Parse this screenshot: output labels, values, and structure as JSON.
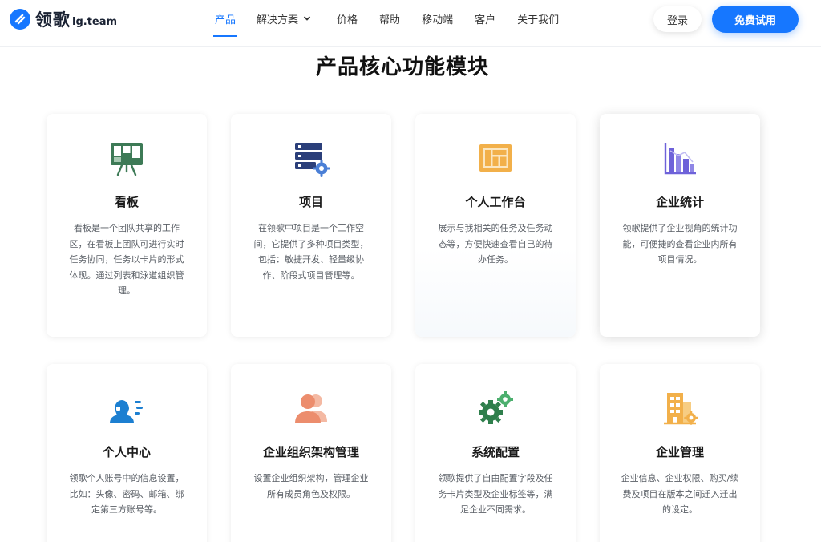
{
  "header": {
    "logo": {
      "name": "领歌",
      "domain": "lg.team"
    },
    "nav": [
      {
        "label": "产品",
        "active": true
      },
      {
        "label": "解决方案",
        "has_dropdown": true
      },
      {
        "label": "价格"
      },
      {
        "label": "帮助"
      },
      {
        "label": "移动端"
      },
      {
        "label": "客户"
      },
      {
        "label": "关于我们"
      }
    ],
    "login_label": "登录",
    "trial_label": "免费试用"
  },
  "section": {
    "title": "产品核心功能模块"
  },
  "cards": [
    {
      "title": "看板",
      "icon": "kanban-board-icon",
      "desc": "看板是一个团队共享的工作区，在看板上团队可进行实时任务协同，任务以卡片的形式体现。通过列表和泳道组织管理。"
    },
    {
      "title": "项目",
      "icon": "project-settings-icon",
      "desc": "在领歌中项目是一个工作空间，它提供了多种项目类型，包括：敏捷开发、轻量级协作、阶段式项目管理等。"
    },
    {
      "title": "个人工作台",
      "icon": "workbench-icon",
      "desc": "展示与我相关的任务及任务动态等，方便快速查看自己的待办任务。"
    },
    {
      "title": "企业统计",
      "icon": "statistics-chart-icon",
      "desc": "领歌提供了企业视角的统计功能，可便捷的查看企业内所有项目情况。"
    },
    {
      "title": "个人中心",
      "icon": "personal-center-icon",
      "desc": "领歌个人账号中的信息设置，比如：头像、密码、邮箱、绑定第三方账号等。"
    },
    {
      "title": "企业组织架构管理",
      "icon": "org-users-icon",
      "desc": "设置企业组织架构，管理企业所有成员角色及权限。"
    },
    {
      "title": "系统配置",
      "icon": "system-gears-icon",
      "desc": "领歌提供了自由配置字段及任务卡片类型及企业标签等，满足企业不同需求。"
    },
    {
      "title": "企业管理",
      "icon": "enterprise-building-icon",
      "desc": "企业信息、企业权限、购买/续费及项目在版本之间迁入迁出的设定。"
    }
  ],
  "colors": {
    "brand": "#1677ff",
    "kanban_green": "#3d7a56",
    "project_navy": "#2b3f7a",
    "workbench_orange": "#f2b04a",
    "stats_purple": "#6e62d9",
    "person_blue": "#1c7fd1",
    "org_salmon": "#ec8d6d",
    "gear_green": "#2f7f4c"
  }
}
